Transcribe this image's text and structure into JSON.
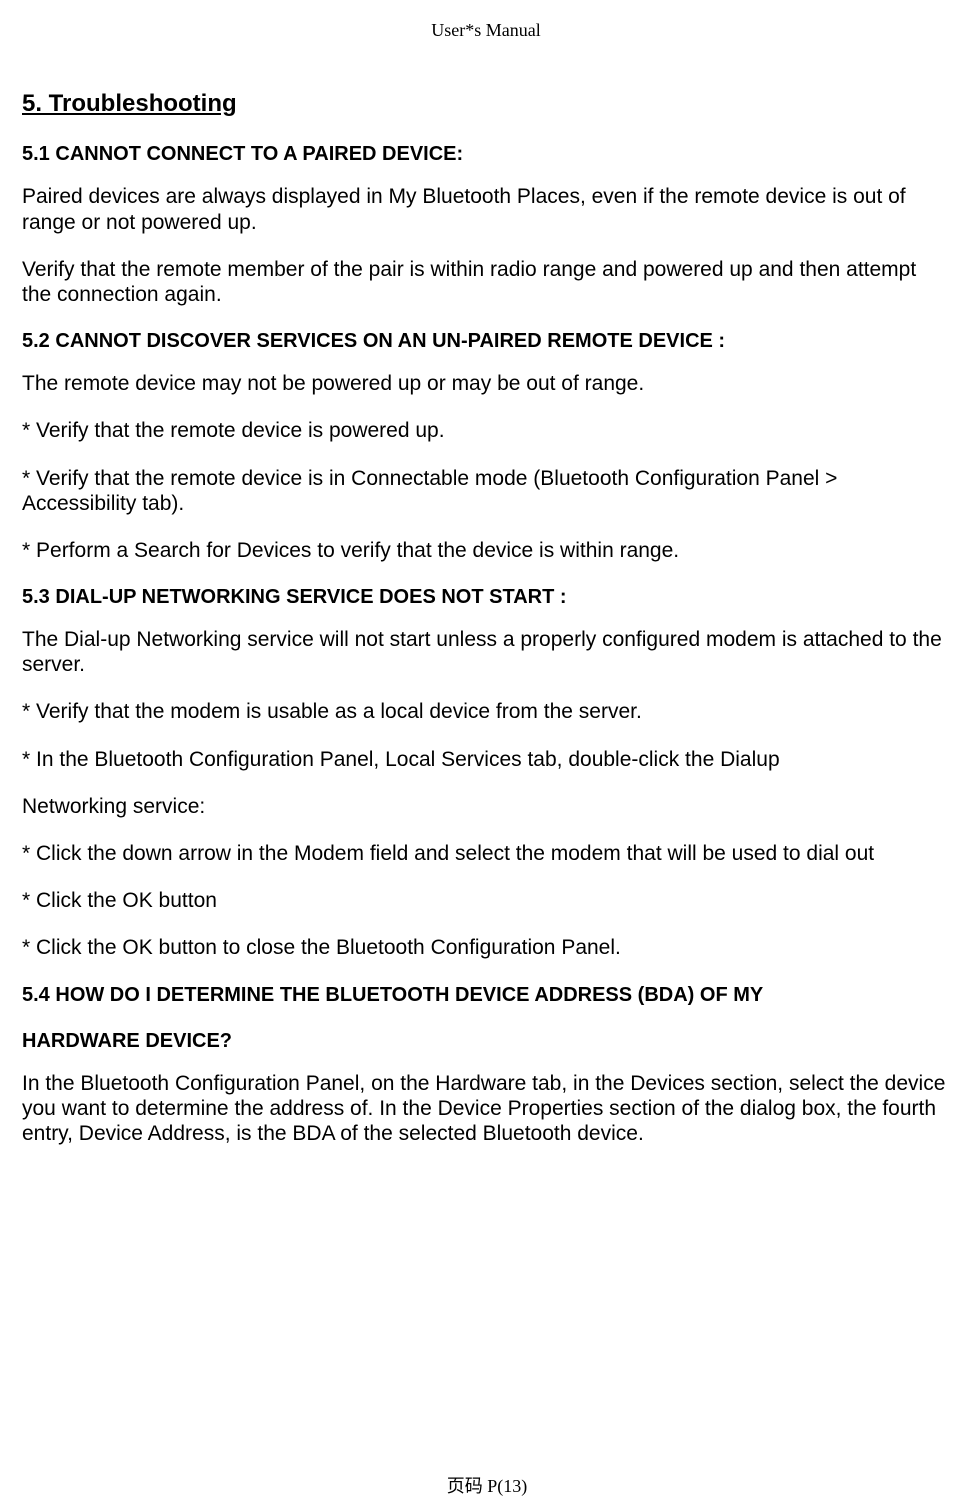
{
  "header": "User*s Manual",
  "h1": "5. Troubleshooting",
  "s51_head_num": "5.1 C",
  "s51_head_rest": "ANNOT CONNECT TO A PAIRED DEVICE:",
  "s51_p1": "Paired devices are always displayed in My Bluetooth Places, even if the remote device is out of range or not powered up.",
  "s51_p2": "Verify that the remote member of the pair is within radio range and powered up and then attempt the connection again.",
  "s52_head_num": "5.2 C",
  "s52_head_rest": "ANNOT DISCOVER SERVICES ON AN UN-PAIRED REMOTE DEVICE :",
  "s52_p1": "The remote device may not be powered up or may be out of range.",
  "s52_b1": "* Verify that the remote device is powered up.",
  "s52_b2": "* Verify that the remote device is in Connectable mode (Bluetooth Configuration Panel > Accessibility tab).",
  "s52_b3": "* Perform a Search for Devices to verify that the device is within range.",
  "s53_head_num": "5.3 D",
  "s53_head_mid1": "IAL-UP ",
  "s53_head_N": "N",
  "s53_head_rest": "ETWORKING SERVICE DOES NOT START :",
  "s53_p1": "The Dial-up Networking service will not start unless a properly configured modem is attached to the server.",
  "s53_b1": "* Verify that the modem is usable as a local device from the server.",
  "s53_b2": "* In the Bluetooth Configuration Panel, Local Services tab, double-click the Dialup",
  "s53_p2": "Networking service:",
  "s53_b3": "* Click the down arrow in the Modem field and select the modem that will be used to dial out",
  "s53_b4": "* Click the OK button",
  "s53_b5": "* Click the OK button to close the Bluetooth Configuration Panel.",
  "s54_head_num": "5.4 H",
  "s54_head_r1": "OW DO ",
  "s54_head_I": "I",
  "s54_head_r2": " DETERMINE THE ",
  "s54_head_B": "B",
  "s54_head_r3": "LUETOOTH ",
  "s54_head_D": "D",
  "s54_head_r4": "EVICE ",
  "s54_head_A": "A",
  "s54_head_r5": "DDRESS ",
  "s54_head_paren": "(BDA)",
  "s54_head_r6": " OF MY",
  "s54_head_line2": "HARDWARE DEVICE?",
  "s54_p1": "In the Bluetooth Configuration Panel, on the Hardware tab, in the Devices section, select the device you want to determine the address of. In the Device Properties section of the dialog box, the fourth entry, Device Address, is the BDA of the selected Bluetooth device.",
  "footer": "页码  P(13)"
}
